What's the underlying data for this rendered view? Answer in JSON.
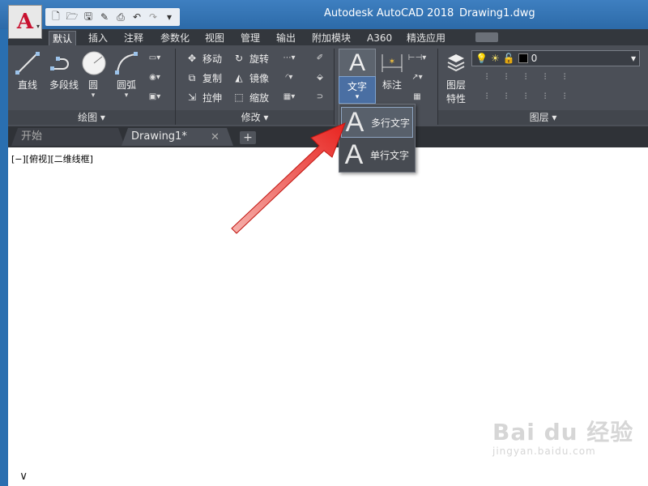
{
  "window": {
    "title": "Autodesk AutoCAD 2018",
    "file": "Drawing1.dwg",
    "app_logo": "A",
    "colors": {
      "titlebar": "#2c6aa8",
      "ribbon": "#4b4f57",
      "accent": "#4a6fa3",
      "logo": "#c8102e",
      "arrow": "#e8231f"
    }
  },
  "quick_access": {
    "icons": [
      "new-icon",
      "open-icon",
      "save-icon",
      "saveas-icon",
      "print-icon",
      "undo-icon",
      "redo-icon",
      "customize-icon"
    ]
  },
  "tabs": [
    {
      "label": "默认",
      "active": true
    },
    {
      "label": "插入"
    },
    {
      "label": "注释"
    },
    {
      "label": "参数化"
    },
    {
      "label": "视图"
    },
    {
      "label": "管理"
    },
    {
      "label": "输出"
    },
    {
      "label": "附加模块"
    },
    {
      "label": "A360"
    },
    {
      "label": "精选应用"
    }
  ],
  "ribbon": {
    "draw": {
      "label": "绘图",
      "line": "直线",
      "polyline": "多段线",
      "circle": "圆",
      "arc": "圆弧"
    },
    "modify": {
      "label": "修改",
      "move": "移动",
      "rotate": "旋转",
      "copy": "复制",
      "mirror": "镜像",
      "stretch": "拉伸",
      "scale": "缩放"
    },
    "annotation": {
      "text": "文字",
      "text_icon": "A",
      "dimension": "标注"
    },
    "layers": {
      "label": "图层",
      "properties": "图层",
      "properties2": "特性",
      "current_layer": "0"
    }
  },
  "file_tabs": {
    "start": "开始",
    "drawing": "Drawing1*",
    "close": "✕",
    "add": "+"
  },
  "canvas": {
    "viewport_label": "[−][俯视][二维线框]"
  },
  "dropdown": {
    "mtext": {
      "icon": "A",
      "label": "多行文字"
    },
    "stext": {
      "icon": "A",
      "label": "单行文字"
    }
  },
  "watermark": {
    "logo": "Bai du 经验",
    "url": "jingyan.baidu.com"
  }
}
